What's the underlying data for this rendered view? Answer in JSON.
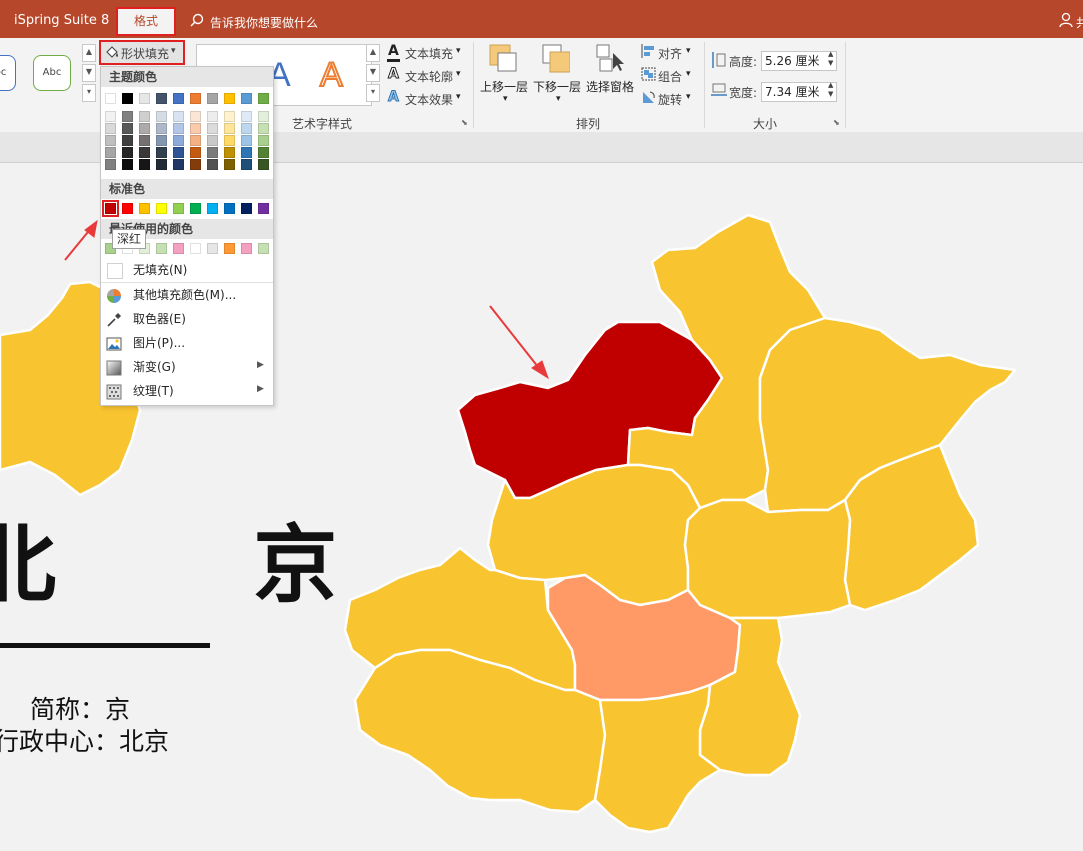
{
  "titlebar": {
    "app_name": "iSpring Suite 8",
    "active_tab": "格式",
    "tell_me": "告诉我你想要做什么",
    "user_initial": "共"
  },
  "ribbon": {
    "shape_fill": "形状填充",
    "shape_style_sample": "Abc",
    "text_fill": "文本填充",
    "text_outline": "文本轮廓",
    "text_effects": "文本效果",
    "wordart_group": "艺术字样式",
    "bring_forward": "上移一层",
    "send_backward": "下移一层",
    "selection_pane": "选择窗格",
    "align": "对齐",
    "group": "组合",
    "rotate": "旋转",
    "arrange_group": "排列",
    "height_label": "高度:",
    "height_value": "5.26 厘米",
    "width_label": "宽度:",
    "width_value": "7.34 厘米",
    "size_group": "大小"
  },
  "dropdown": {
    "theme_colors": "主题颜色",
    "standard_colors": "标准色",
    "recent_colors": "最近使用的颜色",
    "no_fill": "无填充(N)",
    "more_fill_colors": "其他填充颜色(M)...",
    "eyedropper": "取色器(E)",
    "picture": "图片(P)...",
    "gradient": "渐变(G)",
    "texture": "纹理(T)",
    "tooltip": "深红",
    "theme_row": [
      "#ffffff",
      "#000000",
      "#e7e6e6",
      "#44546a",
      "#4472c4",
      "#ed7d31",
      "#a5a5a5",
      "#ffc000",
      "#5b9bd5",
      "#70ad47"
    ],
    "theme_shades": [
      [
        "#f2f2f2",
        "#d9d9d9",
        "#bfbfbf",
        "#a6a6a6",
        "#808080"
      ],
      [
        "#808080",
        "#595959",
        "#404040",
        "#262626",
        "#0d0d0d"
      ],
      [
        "#d0cece",
        "#aeaaaa",
        "#757171",
        "#3a3838",
        "#171616"
      ],
      [
        "#d6dce4",
        "#adb9ca",
        "#8496b0",
        "#333f4f",
        "#222a35"
      ],
      [
        "#d9e2f3",
        "#b4c6e7",
        "#8eaadb",
        "#2f5496",
        "#1f3864"
      ],
      [
        "#fbe5d5",
        "#f7cbac",
        "#f4b183",
        "#c55a11",
        "#843c0b"
      ],
      [
        "#ededed",
        "#dbdbdb",
        "#c9c9c9",
        "#7b7b7b",
        "#525252"
      ],
      [
        "#fff2cc",
        "#fee599",
        "#ffd965",
        "#bf9000",
        "#7f6000"
      ],
      [
        "#deebf6",
        "#bdd7ee",
        "#9dc3e6",
        "#2e75b5",
        "#1f4e79"
      ],
      [
        "#e2efd9",
        "#c5e0b3",
        "#a8d08d",
        "#548235",
        "#375623"
      ]
    ],
    "standard_row": [
      "#c00000",
      "#ff0000",
      "#ffc000",
      "#ffff00",
      "#92d050",
      "#00b050",
      "#00b0f0",
      "#0070c0",
      "#002060",
      "#7030a0"
    ],
    "recent_row": [
      "#a9d18e",
      "#ffffff",
      "#e2efd9",
      "#c5e0b3",
      "#f4a0c0",
      "#ffffff",
      "#e7e6e6",
      "#ff9933",
      "#f4a0c0",
      "#c5e0b3"
    ]
  },
  "slide": {
    "title": "北 京",
    "abbr": "简称：京",
    "center": "行政中心：北京"
  },
  "colors": {
    "map_yellow": "#f8c430",
    "map_dark_red": "#c00000",
    "map_orange": "#ff9966",
    "accent": "#b7472a",
    "arrow": "#e83a3a"
  }
}
